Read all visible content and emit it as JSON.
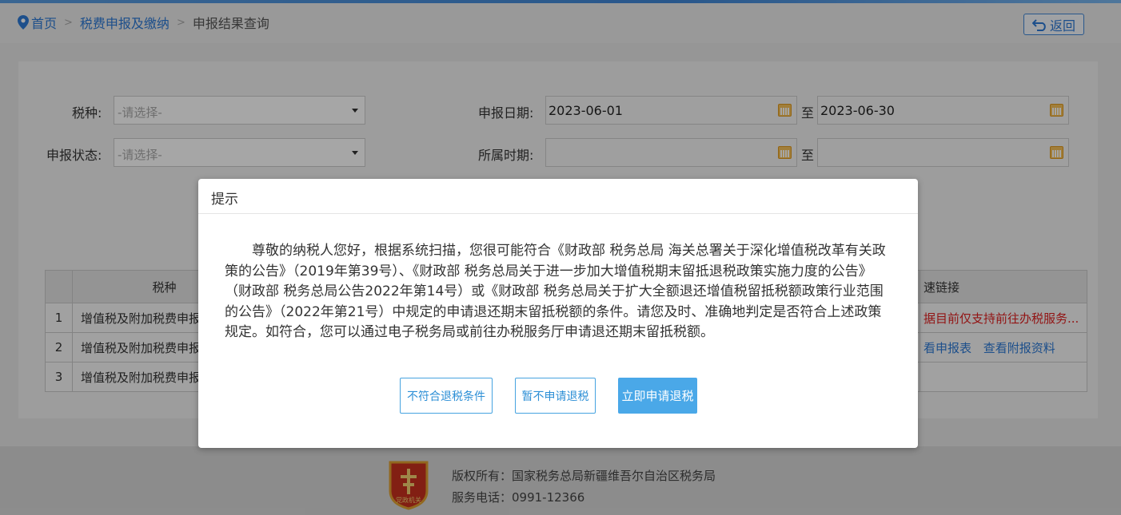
{
  "breadcrumb": {
    "home": "首页",
    "level1": "税费申报及缴纳",
    "current": "申报结果查询",
    "separator": ">"
  },
  "back_button": "返回",
  "filters": {
    "tax_type_label": "税种:",
    "tax_type_placeholder": "-请选择-",
    "status_label": "申报状态:",
    "status_placeholder": "-请选择-",
    "date_label": "申报日期:",
    "date_from": "2023-06-01",
    "date_to": "2023-06-30",
    "to_text": "至",
    "period_label": "所属时期:",
    "period_from": "",
    "period_to": ""
  },
  "table": {
    "headers": [
      "税种",
      "速链接"
    ],
    "rows": [
      {
        "index": "1",
        "name": "增值税及附加税费申报",
        "link_text": "据目前仅支持前往办税服务..."
      },
      {
        "index": "2",
        "name": "增值税及附加税费申报",
        "link_a": "看申报表",
        "link_b": "查看附报资料"
      },
      {
        "index": "3",
        "name": "增值税及附加税费申报"
      }
    ]
  },
  "footer": {
    "copyright": "版权所有：国家税务总局新疆维吾尔自治区税务局",
    "phone": "服务电话：0991-12366",
    "emblem_text": "党政机关"
  },
  "modal": {
    "title": "提示",
    "body": "尊敬的纳税人您好，根据系统扫描，您很可能符合《财政部 税务总局 海关总署关于深化增值税改革有关政策的公告》（2019年第39号）、《财政部 税务总局关于进一步加大增值税期末留抵退税政策实施力度的公告》（财政部 税务总局公告2022年第14号）或《财政部 税务总局关于扩大全额退还增值税留抵税额政策行业范围的公告》（2022年第21号）中规定的申请退还期末留抵税额的条件。请您及时、准确地判定是否符合上述政策规定。如符合，您可以通过电子税务局或前往办税服务厅申请退还期末留抵税额。",
    "btn_not_eligible": "不符合退税条件",
    "btn_later": "暂不申请退税",
    "btn_apply": "立即申请退税"
  },
  "colors": {
    "link_blue": "#2d7ad6",
    "warning_red": "#e02020",
    "primary_button": "#4aa8e8"
  }
}
